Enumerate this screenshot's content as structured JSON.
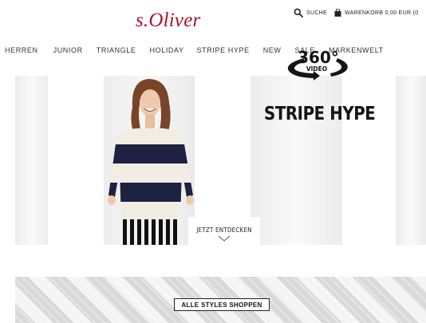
{
  "brand": {
    "logo_text": "s.Oliver",
    "color": "#b0112a"
  },
  "utility": {
    "search_label": "SUCHE",
    "cart_label": "WARENKORB 0,00 EUR (0"
  },
  "nav": {
    "items": [
      {
        "label": "HERREN"
      },
      {
        "label": "JUNIOR"
      },
      {
        "label": "TRIANGLE"
      },
      {
        "label": "HOLIDAY"
      },
      {
        "label": "STRIPE HYPE"
      },
      {
        "label": "NEW"
      },
      {
        "label": "SALE"
      },
      {
        "label": "MARKENWELT"
      }
    ]
  },
  "hero": {
    "badge_number": "360°",
    "badge_word": "VIDEO",
    "campaign_title": "STRIPE HYPE",
    "cta_label": "JETZT ENTDECKEN"
  },
  "banner": {
    "button_label": "ALLE STYLES SHOPPEN"
  }
}
